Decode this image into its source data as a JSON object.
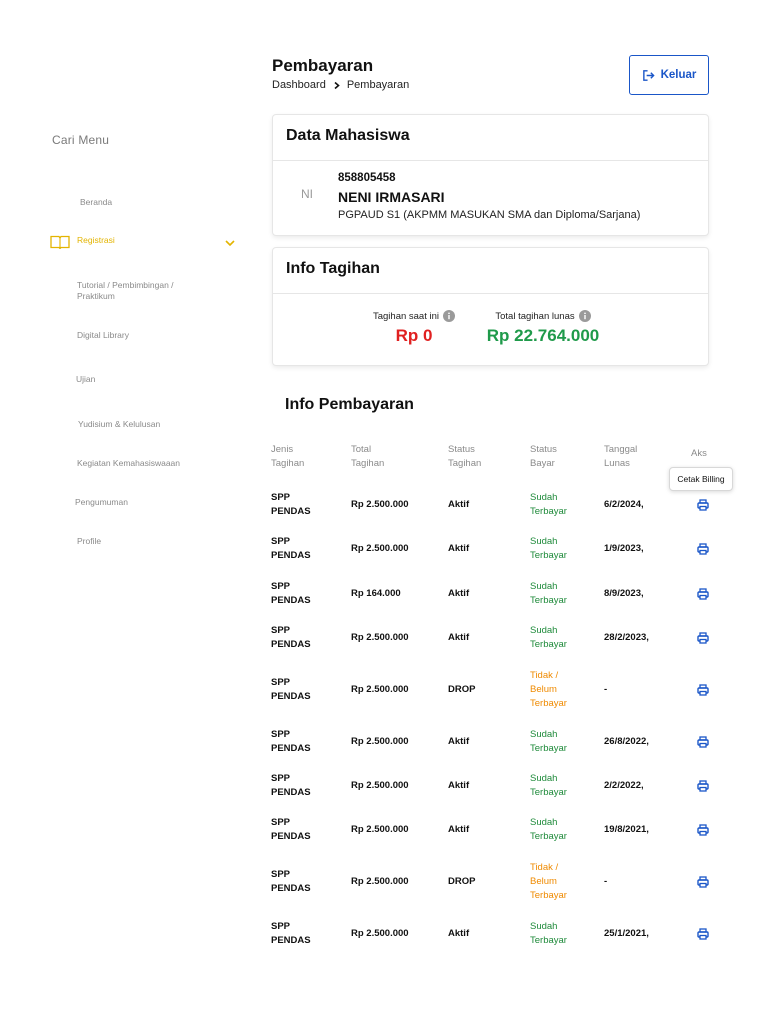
{
  "sidebar": {
    "search_label": "Cari Menu",
    "items": [
      {
        "label": "Beranda"
      },
      {
        "label": "Registrasi"
      },
      {
        "label": "Tutorial / Pembimbingan /\nPraktikum"
      },
      {
        "label": "Digital Library"
      },
      {
        "label": "Ujian"
      },
      {
        "label": "Yudisium & Kelulusan"
      },
      {
        "label": "Kegiatan Kemahasiswaaan"
      },
      {
        "label": "Pengumuman"
      },
      {
        "label": "Profile"
      }
    ],
    "active_color": "#e3b400"
  },
  "header": {
    "title": "Pembayaran",
    "breadcrumb": [
      "Dashboard",
      "Pembayaran"
    ],
    "logout_label": "Keluar"
  },
  "student": {
    "card_title": "Data Mahasiswa",
    "avatar": "NI",
    "nim": "858805458",
    "name": "NENI IRMASARI",
    "program": "PGPAUD S1 (AKPMM MASUKAN SMA dan Diploma/Sarjana)"
  },
  "billing": {
    "card_title": "Info Tagihan",
    "current_label": "Tagihan saat ini",
    "current_value": "Rp 0",
    "paid_label": "Total tagihan lunas",
    "paid_value": "Rp 22.764.000"
  },
  "payments": {
    "title": "Info Pembayaran",
    "columns": {
      "type": "Jenis\nTagihan",
      "total": "Total\nTagihan",
      "status": "Status\nTagihan",
      "pay_status": "Status\nBayar",
      "date": "Tanggal\nLunas",
      "action": "Aks"
    },
    "tooltip": "Cetak Billing",
    "rows": [
      {
        "type": "SPP\nPENDAS",
        "total": "Rp 2.500.000",
        "status": "Aktif",
        "pay_status": "Sudah\nTerbayar",
        "paid": true,
        "date": "6/2/2024,"
      },
      {
        "type": "SPP\nPENDAS",
        "total": "Rp 2.500.000",
        "status": "Aktif",
        "pay_status": "Sudah\nTerbayar",
        "paid": true,
        "date": "1/9/2023,"
      },
      {
        "type": "SPP\nPENDAS",
        "total": "Rp 164.000",
        "status": "Aktif",
        "pay_status": "Sudah\nTerbayar",
        "paid": true,
        "date": "8/9/2023,"
      },
      {
        "type": "SPP\nPENDAS",
        "total": "Rp 2.500.000",
        "status": "Aktif",
        "pay_status": "Sudah\nTerbayar",
        "paid": true,
        "date": "28/2/2023,"
      },
      {
        "type": "SPP\nPENDAS",
        "total": "Rp 2.500.000",
        "status": "DROP",
        "pay_status": "Tidak /\nBelum\nTerbayar",
        "paid": false,
        "date": "-"
      },
      {
        "type": "SPP\nPENDAS",
        "total": "Rp 2.500.000",
        "status": "Aktif",
        "pay_status": "Sudah\nTerbayar",
        "paid": true,
        "date": "26/8/2022,"
      },
      {
        "type": "SPP\nPENDAS",
        "total": "Rp 2.500.000",
        "status": "Aktif",
        "pay_status": "Sudah\nTerbayar",
        "paid": true,
        "date": "2/2/2022,"
      },
      {
        "type": "SPP\nPENDAS",
        "total": "Rp 2.500.000",
        "status": "Aktif",
        "pay_status": "Sudah\nTerbayar",
        "paid": true,
        "date": "19/8/2021,"
      },
      {
        "type": "SPP\nPENDAS",
        "total": "Rp 2.500.000",
        "status": "DROP",
        "pay_status": "Tidak /\nBelum\nTerbayar",
        "paid": false,
        "date": "-"
      },
      {
        "type": "SPP\nPENDAS",
        "total": "Rp 2.500.000",
        "status": "Aktif",
        "pay_status": "Sudah\nTerbayar",
        "paid": true,
        "date": "25/1/2021,"
      }
    ],
    "colors": {
      "paid": "#1e8a3a",
      "unpaid": "#ef8a00",
      "action": "#1a56c8"
    },
    "action_icon": "printer-icon"
  }
}
